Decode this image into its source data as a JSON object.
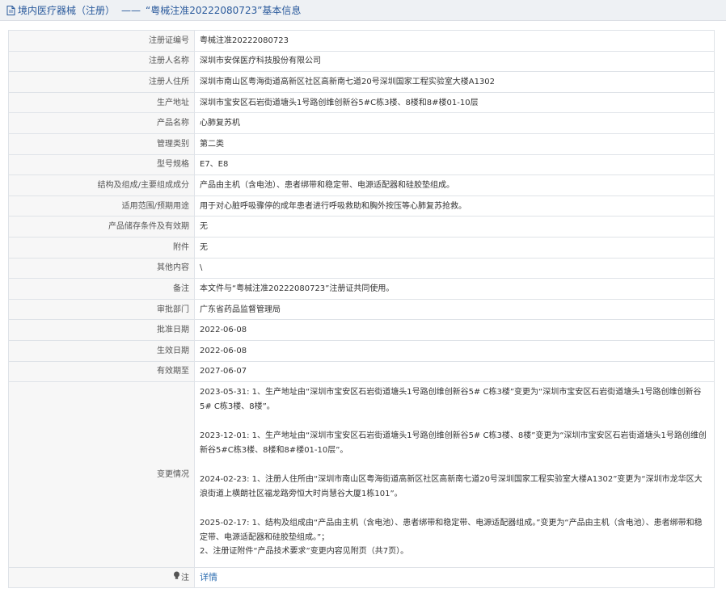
{
  "header": {
    "title": "境内医疗器械（注册）",
    "separator": "——",
    "subtitle": "“粤械注准20222080723”基本信息"
  },
  "rows": [
    {
      "label": "注册证编号",
      "value": "粤械注准20222080723"
    },
    {
      "label": "注册人名称",
      "value": "深圳市安保医疗科技股份有限公司"
    },
    {
      "label": "注册人住所",
      "value": "深圳市南山区粤海街道高新区社区高新南七道20号深圳国家工程实验室大楼A1302"
    },
    {
      "label": "生产地址",
      "value": "深圳市宝安区石岩街道塘头1号路创维创新谷5#C栋3楼、8楼和8#楼01-10层"
    },
    {
      "label": "产品名称",
      "value": "心肺复苏机"
    },
    {
      "label": "管理类别",
      "value": "第二类"
    },
    {
      "label": "型号规格",
      "value": "E7、E8"
    },
    {
      "label": "结构及组成/主要组成成分",
      "value": "产品由主机（含电池）、患者绑带和稳定带、电源适配器和硅胶垫组成。"
    },
    {
      "label": "适用范围/预期用途",
      "value": "用于对心脏呼吸骤停的成年患者进行呼吸救助和胸外按压等心肺复苏抢救。"
    },
    {
      "label": "产品储存条件及有效期",
      "value": "无"
    },
    {
      "label": "附件",
      "value": "无"
    },
    {
      "label": "其他内容",
      "value": "\\"
    },
    {
      "label": "备注",
      "value": "本文件与“粤械注准20222080723”注册证共同使用。"
    },
    {
      "label": "审批部门",
      "value": "广东省药品监督管理局"
    },
    {
      "label": "批准日期",
      "value": "2022-06-08"
    },
    {
      "label": "生效日期",
      "value": "2022-06-08"
    },
    {
      "label": "有效期至",
      "value": "2027-06-07"
    }
  ],
  "changes": {
    "label": "变更情况",
    "entries": [
      "2023-05-31: 1、生产地址由“深圳市宝安区石岩街道塘头1号路创维创新谷5# C栋3楼”变更为“深圳市宝安区石岩街道塘头1号路创维创新谷5# C栋3楼、8楼”。",
      "2023-12-01: 1、生产地址由“深圳市宝安区石岩街道塘头1号路创维创新谷5# C栋3楼、8楼”变更为“深圳市宝安区石岩街道塘头1号路创维创新谷5#C栋3楼、8楼和8#楼01-10层”。",
      "2024-02-23: 1、注册人住所由“深圳市南山区粤海街道高新区社区高新南七道20号深圳国家工程实验室大楼A1302”变更为“深圳市龙华区大浪街道上横朗社区福龙路旁恒大时尚慧谷大厦1栋101”。",
      "2025-02-17: 1、结构及组成由“产品由主机（含电池）、患者绑带和稳定带、电源适配器组成。”变更为“产品由主机（含电池）、患者绑带和稳定带、电源适配器和硅胶垫组成。”；\n2、注册证附件“产品技术要求”变更内容见附页（共7页）。"
    ]
  },
  "note": {
    "label": "注",
    "link": "详情"
  }
}
